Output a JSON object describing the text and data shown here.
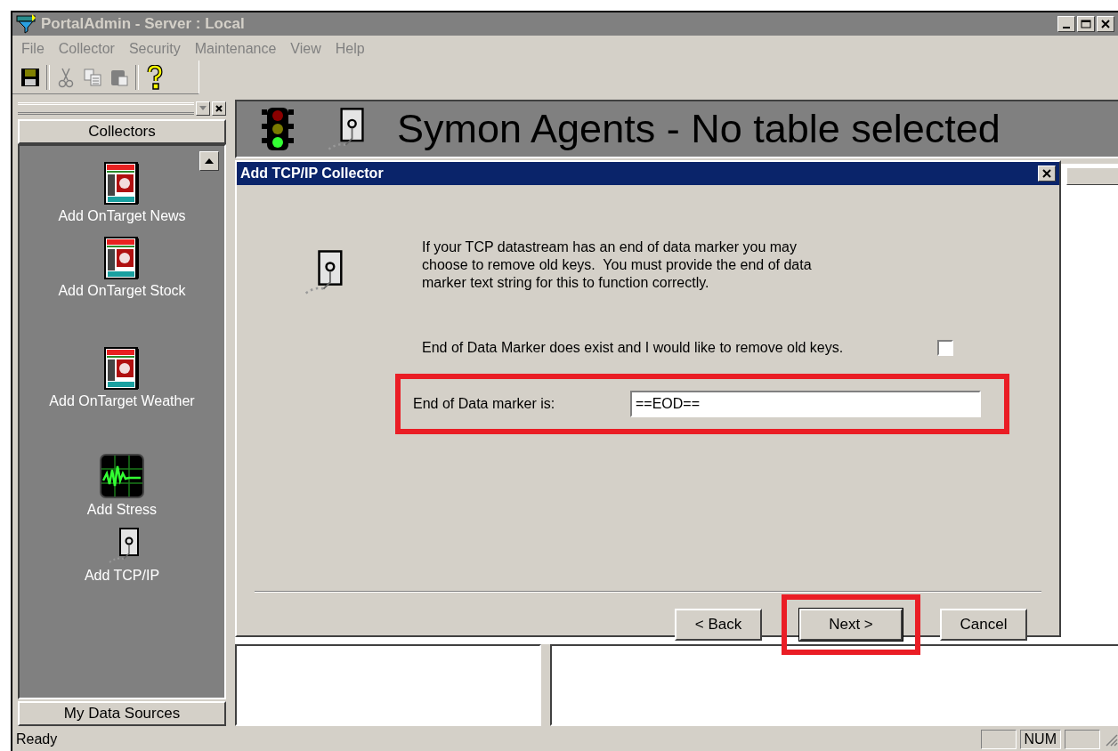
{
  "window": {
    "title": "PortalAdmin - Server : Local",
    "active": false
  },
  "menu": [
    {
      "label": "File",
      "disabled": true
    },
    {
      "label": "Collector",
      "disabled": true
    },
    {
      "label": "Security",
      "disabled": true
    },
    {
      "label": "Maintenance",
      "disabled": true
    },
    {
      "label": "View",
      "disabled": true
    },
    {
      "label": "Help",
      "disabled": true
    }
  ],
  "toolbar": [
    {
      "kind": "save",
      "disabled": false
    },
    {
      "kind": "separator"
    },
    {
      "kind": "cut",
      "disabled": true
    },
    {
      "kind": "copy",
      "disabled": true
    },
    {
      "kind": "paste",
      "disabled": true
    },
    {
      "kind": "separator"
    },
    {
      "kind": "help",
      "disabled": false
    }
  ],
  "sidebar": {
    "header": "Collectors",
    "items": [
      {
        "label": "Add OnTarget News",
        "kind": "newspaper"
      },
      {
        "label": "Add OnTarget Stock",
        "kind": "newspaper"
      },
      {
        "label": "Add OnTarget Weather",
        "kind": "newspaper"
      },
      {
        "label": "Add Stress",
        "kind": "monitor"
      },
      {
        "label": "Add TCP/IP",
        "kind": "plug"
      }
    ],
    "footer": "My Data Sources"
  },
  "header": {
    "title": "Symon Agents - No table selected"
  },
  "dialog": {
    "title": "Add TCP/IP Collector",
    "description": "If your TCP datastream has an end of data marker you may choose to remove old keys.  You must provide the end of data marker text string for this to function correctly.",
    "checkbox": {
      "label": "End of Data Marker does exist and I would like to remove old keys.",
      "checked": false
    },
    "field": {
      "label": "End of Data marker is:",
      "value": "==EOD==",
      "highlighted": true
    },
    "buttons": [
      {
        "label": "< Back",
        "default": false,
        "highlighted": false
      },
      {
        "label": "Next >",
        "default": true,
        "highlighted": true
      },
      {
        "label": "Cancel",
        "default": false,
        "highlighted": false
      }
    ]
  },
  "status_bar": {
    "text": "Ready",
    "indicators": [
      "NUM"
    ]
  }
}
